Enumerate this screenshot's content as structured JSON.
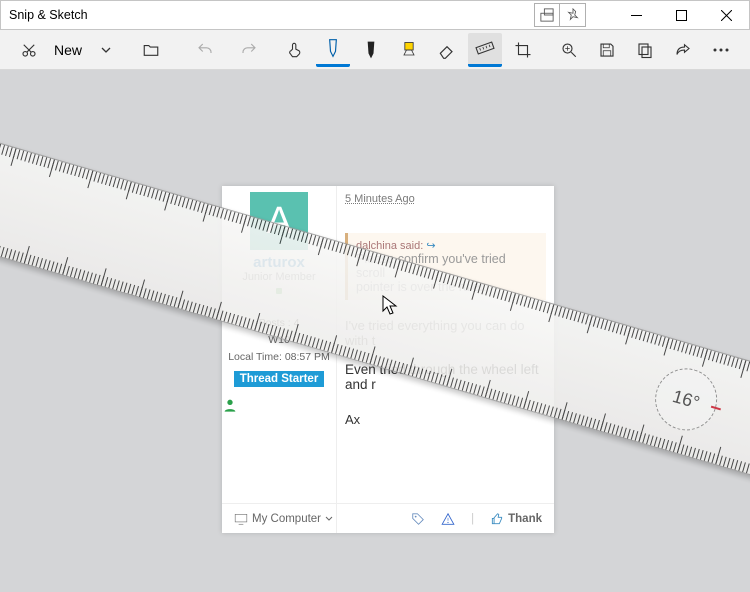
{
  "window": {
    "title": "Snip & Sketch"
  },
  "toolbar": {
    "new_label": "New"
  },
  "ruler": {
    "angle": "16°"
  },
  "post": {
    "timestamp": "5 Minutes Ago",
    "user": {
      "name": "arturox",
      "rank": "Junior Member"
    },
    "meta": {
      "posts_label": "Posts :",
      "posts_value": "4",
      "os": "W10",
      "localtime_label": "Local Time:",
      "localtime_value": "08:57 PM"
    },
    "starter": "Thread Starter",
    "quote": {
      "from": "dalchina said:",
      "text": "Please confirm you've tried scroll\npointer is over the ruler."
    },
    "line1": "I've tried everything you can do with t",
    "line2": "Even tried through the wheel left and r",
    "sign": "Ax",
    "footer": {
      "mycomputer": "My Computer",
      "thank": "Thank"
    }
  }
}
